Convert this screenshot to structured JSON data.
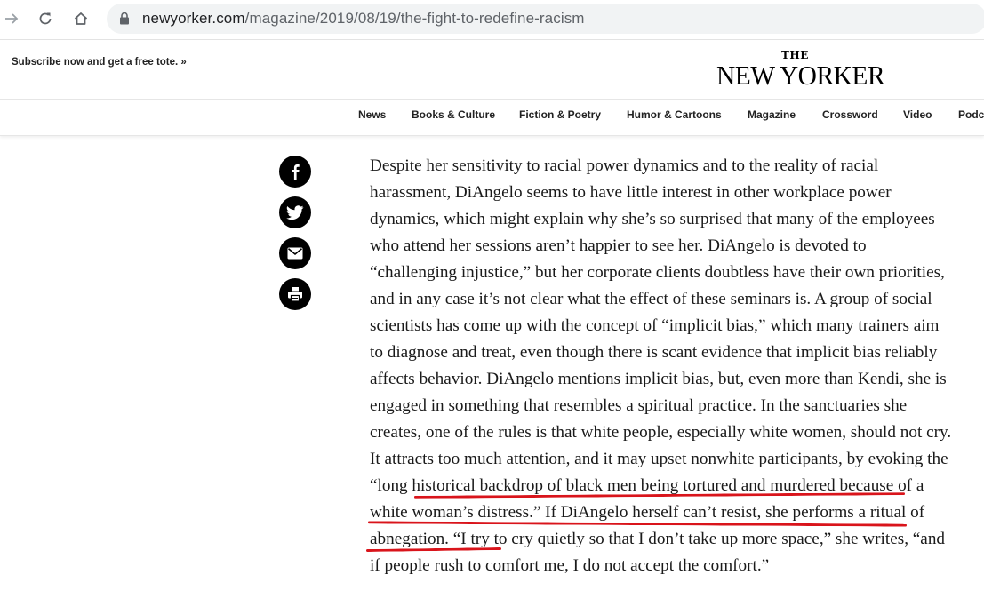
{
  "browser": {
    "url_domain": "newyorker.com",
    "url_path": "/magazine/2019/08/19/the-fight-to-redefine-racism"
  },
  "header": {
    "subscribe": "Subscribe now and get a free tote. »",
    "logo_the": "THE",
    "logo_main": "NEW YORKER"
  },
  "nav": {
    "items": [
      "News",
      "Books & Culture",
      "Fiction & Poetry",
      "Humor & Cartoons",
      "Magazine",
      "Crossword",
      "Video",
      "Podc"
    ]
  },
  "article": {
    "paragraph": "Despite her sensitivity to racial power dynamics and to the reality of racial harassment, DiAngelo seems to have little interest in other workplace power dynamics, which might explain why she’s so surprised that many of the employees who attend her sessions aren’t happier to see her. DiAngelo is devoted to “challenging injustice,” but her corporate clients doubtless have their own priorities, and in any case it’s not clear what the effect of these seminars is. A group of social scientists has come up with the concept of “implicit bias,” which many trainers aim to diagnose and treat, even though there is scant evidence that implicit bias reliably affects behavior. DiAngelo mentions implicit bias, but, even more than Kendi, she is engaged in something that resembles a spiritual practice. In the sanctuaries she creates, one of the rules is that white people, especially white women, should not cry. It attracts too much attention, and it may upset nonwhite participants, by evoking the “long historical backdrop of black men being tortured and murdered because of a white woman’s distress.” If DiAngelo herself can’t resist, she performs a ritual of abnegation. “I try to cry quietly so that I don’t take up more space,” she writes, “and if people rush to comfort me, I do not accept the comfort.”",
    "highlighted_phrase": "may upset nonwhite participants, by evoking the “long historical backdrop of black men being tortured and murdered because of a white woman’s distress.”",
    "highlight_color": "#d9141b"
  },
  "share_icons": [
    "facebook-icon",
    "twitter-icon",
    "email-icon",
    "print-icon"
  ]
}
